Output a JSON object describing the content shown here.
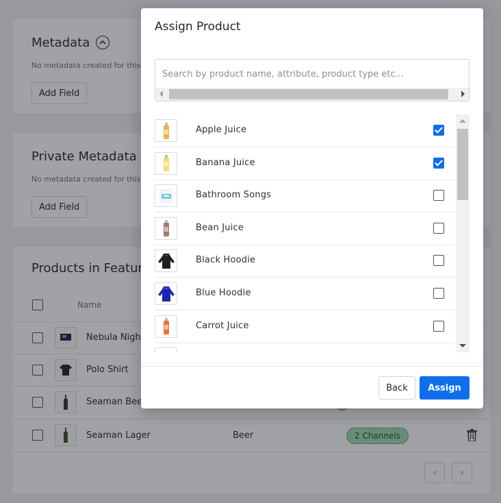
{
  "background": {
    "metadata": {
      "title": "Metadata",
      "empty_text": "No metadata created for this",
      "add_field_label": "Add Field"
    },
    "private_metadata": {
      "title": "Private Metadata",
      "empty_text": "No metadata created for this",
      "add_field_label": "Add Field"
    },
    "products": {
      "title": "Products in Feature",
      "column_name": "Name",
      "rows": [
        {
          "name": "Nebula Nigh",
          "type": "",
          "channels": ""
        },
        {
          "name": "Polo Shirt",
          "type": "",
          "channels": ""
        },
        {
          "name": "Seaman Bee",
          "type": "",
          "channels": ""
        },
        {
          "name": "Seaman Lager",
          "type": "Beer",
          "channels": "2 Channels"
        }
      ]
    }
  },
  "dialog": {
    "title": "Assign Product",
    "search": {
      "value": "",
      "placeholder": "Search by product name, attribute, product type etc..."
    },
    "products": [
      {
        "name": "Apple Juice",
        "checked": true,
        "icon": "juice-bottle-icon",
        "color": "#e6b84a"
      },
      {
        "name": "Banana Juice",
        "checked": true,
        "icon": "juice-bottle-icon",
        "color": "#f0dc6a"
      },
      {
        "name": "Bathroom Songs",
        "checked": false,
        "icon": "album-cover-icon",
        "color": "#7fc4d8"
      },
      {
        "name": "Bean Juice",
        "checked": false,
        "icon": "juice-bottle-icon",
        "color": "#a07a72"
      },
      {
        "name": "Black Hoodie",
        "checked": false,
        "icon": "hoodie-icon",
        "color": "#1e1e22"
      },
      {
        "name": "Blue Hoodie",
        "checked": false,
        "icon": "hoodie-icon",
        "color": "#1f23b0"
      },
      {
        "name": "Carrot Juice",
        "checked": false,
        "icon": "juice-bottle-icon",
        "color": "#e4733a"
      }
    ],
    "back_label": "Back",
    "assign_label": "Assign"
  },
  "colors": {
    "accent": "#0e6fe8",
    "chip_bg": "#9fd8b0"
  }
}
